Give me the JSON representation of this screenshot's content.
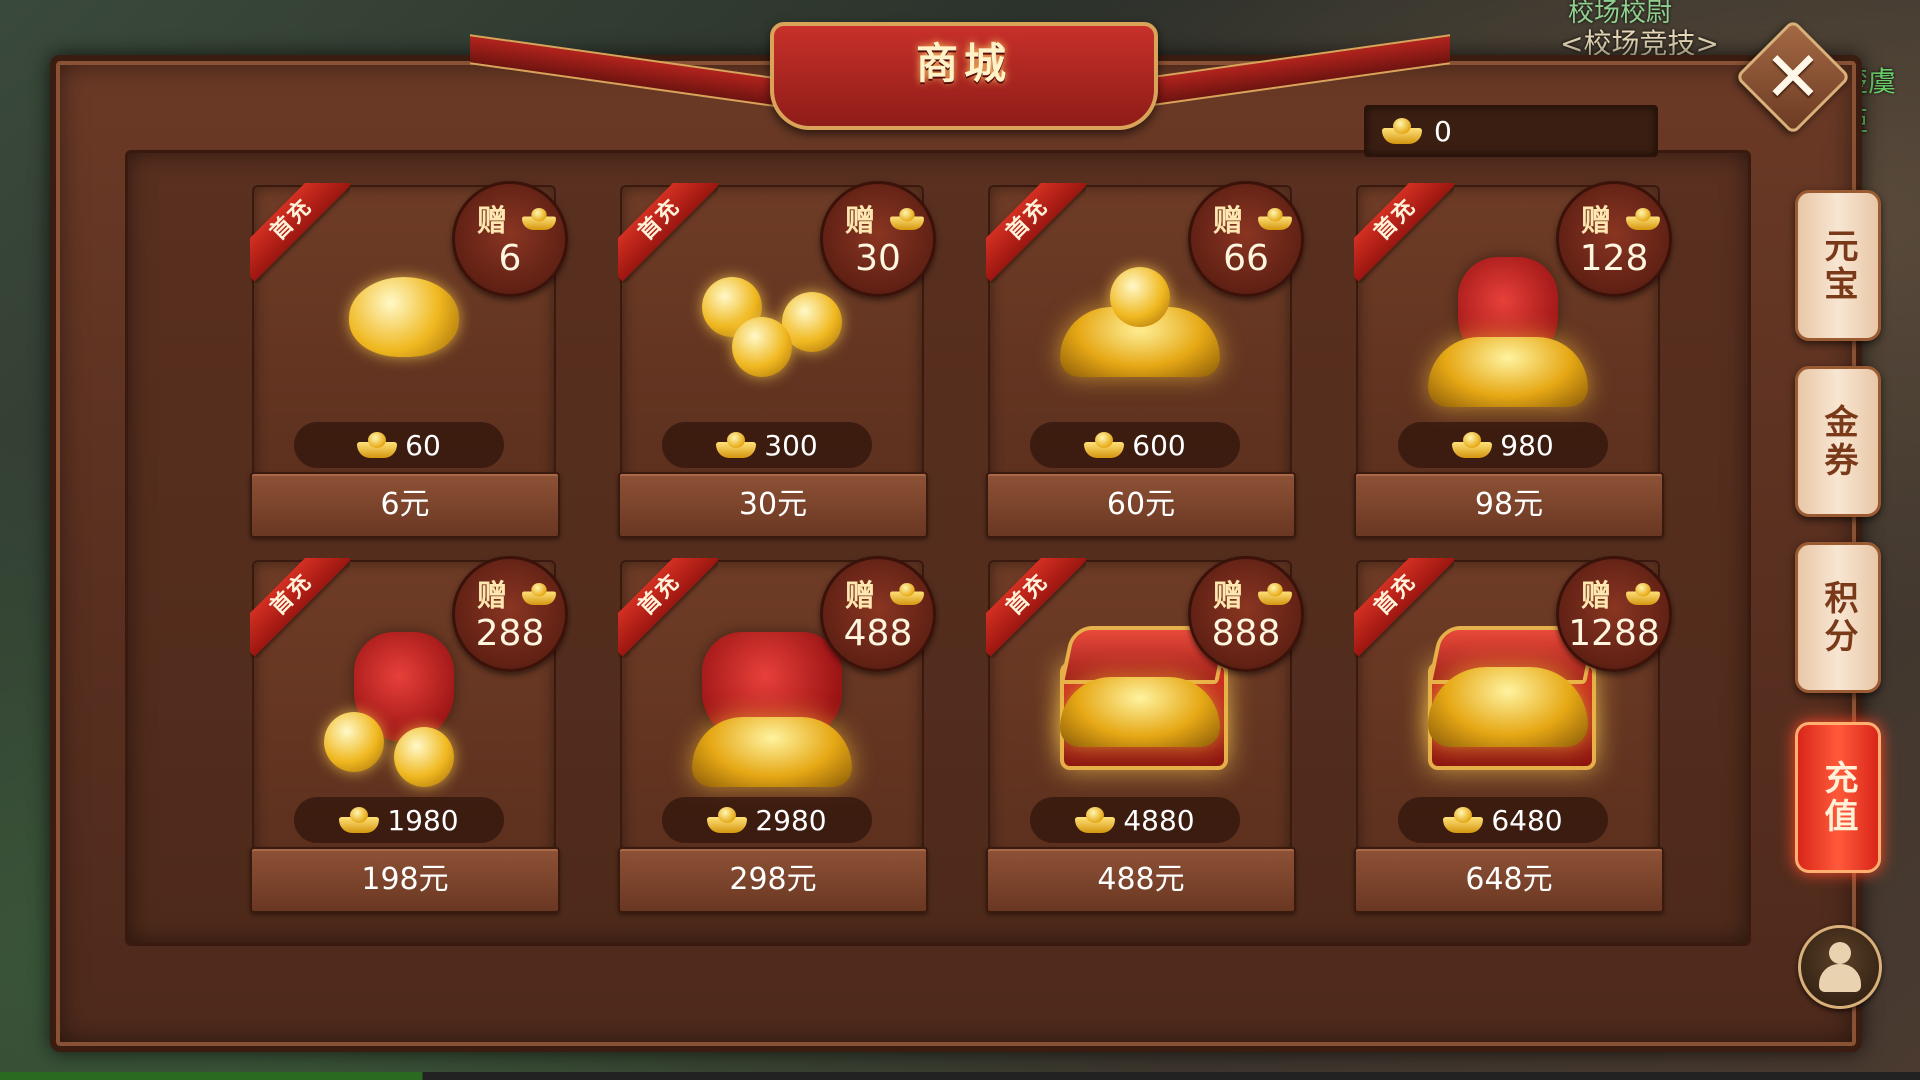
{
  "background": {
    "labels": [
      "校场校尉",
      "<校场竞技>",
      "楚虞姬"
    ]
  },
  "header": {
    "title": "商城",
    "currency_icon": "gold-ingot-icon",
    "balance": "0"
  },
  "close_icon": "close-icon",
  "close_label": "✕",
  "ribbon_label": "首充",
  "bonus_label": "赠",
  "products": [
    {
      "bonus": "6",
      "amount": "60",
      "price": "6元"
    },
    {
      "bonus": "30",
      "amount": "300",
      "price": "30元"
    },
    {
      "bonus": "66",
      "amount": "600",
      "price": "60元"
    },
    {
      "bonus": "128",
      "amount": "980",
      "price": "98元"
    },
    {
      "bonus": "288",
      "amount": "1980",
      "price": "198元"
    },
    {
      "bonus": "488",
      "amount": "2980",
      "price": "298元"
    },
    {
      "bonus": "888",
      "amount": "4880",
      "price": "488元"
    },
    {
      "bonus": "1288",
      "amount": "6480",
      "price": "648元"
    }
  ],
  "side_tabs": [
    {
      "label": "元宝",
      "active": false
    },
    {
      "label": "金券",
      "active": false
    },
    {
      "label": "积分",
      "active": false
    },
    {
      "label": "充值",
      "active": true
    }
  ],
  "avatar_icon": "character-avatar-icon",
  "colors": {
    "accent_red": "#c8302a",
    "gold": "#e6a815",
    "panel_brown": "#5a3020",
    "active_tab": "#ff5a3a"
  }
}
